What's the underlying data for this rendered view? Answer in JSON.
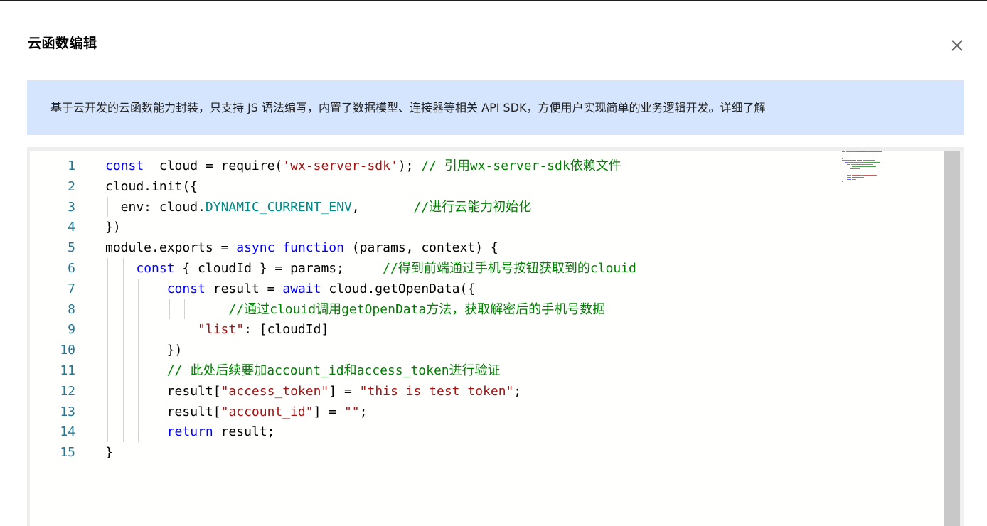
{
  "dialog": {
    "title": "云函数编辑",
    "close_icon": "close-icon"
  },
  "notice": {
    "text": "基于云开发的云函数能力封装，只支持 JS 语法编写，内置了数据模型、连接器等相关 API SDK，方便用户实现简单的业务逻辑开发。",
    "link": "详细了解"
  },
  "editor": {
    "lines": [
      {
        "num": "1",
        "tokens": [
          [
            "kw",
            "const"
          ],
          [
            "",
            "  cloud = require("
          ],
          [
            "str",
            "'wx-server-sdk'"
          ],
          [
            "",
            "); "
          ],
          [
            "cm",
            "// 引用wx-server-sdk依赖文件"
          ]
        ]
      },
      {
        "num": "2",
        "tokens": [
          [
            "",
            "cloud.init({"
          ]
        ]
      },
      {
        "num": "3",
        "tokens": [
          [
            "",
            "  env: cloud."
          ],
          [
            "prop",
            "DYNAMIC_CURRENT_ENV"
          ],
          [
            "",
            ",       "
          ],
          [
            "cm",
            "//进行云能力初始化"
          ]
        ]
      },
      {
        "num": "4",
        "tokens": [
          [
            "",
            "})"
          ]
        ]
      },
      {
        "num": "5",
        "tokens": [
          [
            "",
            "module.exports = "
          ],
          [
            "kw",
            "async"
          ],
          [
            "",
            " "
          ],
          [
            "kw",
            "function"
          ],
          [
            "",
            " (params, context) {"
          ]
        ]
      },
      {
        "num": "6",
        "tokens": [
          [
            "",
            "    "
          ],
          [
            "kw",
            "const"
          ],
          [
            "",
            " { cloudId } = params;     "
          ],
          [
            "cm",
            "//得到前端通过手机号按钮获取到的clouid"
          ]
        ]
      },
      {
        "num": "7",
        "tokens": [
          [
            "",
            "        "
          ],
          [
            "kw",
            "const"
          ],
          [
            "",
            " result = "
          ],
          [
            "kw",
            "await"
          ],
          [
            "",
            " cloud.getOpenData({"
          ]
        ]
      },
      {
        "num": "8",
        "tokens": [
          [
            "",
            "                "
          ],
          [
            "cm",
            "//通过clouid调用getOpenData方法，获取解密后的手机号数据"
          ]
        ]
      },
      {
        "num": "9",
        "tokens": [
          [
            "",
            "            "
          ],
          [
            "str",
            "\"list\""
          ],
          [
            "",
            ": [cloudId]"
          ]
        ]
      },
      {
        "num": "10",
        "tokens": [
          [
            "",
            "        })"
          ]
        ]
      },
      {
        "num": "11",
        "tokens": [
          [
            "",
            "        "
          ],
          [
            "cm",
            "// 此处后续要加account_id和access_token进行验证"
          ]
        ]
      },
      {
        "num": "12",
        "tokens": [
          [
            "",
            "        result["
          ],
          [
            "str",
            "\"access_token\""
          ],
          [
            "",
            "] = "
          ],
          [
            "str",
            "\"this is test token\""
          ],
          [
            "",
            ";"
          ]
        ]
      },
      {
        "num": "13",
        "tokens": [
          [
            "",
            "        result["
          ],
          [
            "str",
            "\"account_id\""
          ],
          [
            "",
            "] = "
          ],
          [
            "str",
            "\"\""
          ],
          [
            "",
            ";"
          ]
        ]
      },
      {
        "num": "14",
        "tokens": [
          [
            "",
            "        "
          ],
          [
            "kw",
            "return"
          ],
          [
            "",
            " result;"
          ]
        ]
      },
      {
        "num": "15",
        "tokens": [
          [
            "",
            "}"
          ]
        ]
      }
    ]
  }
}
